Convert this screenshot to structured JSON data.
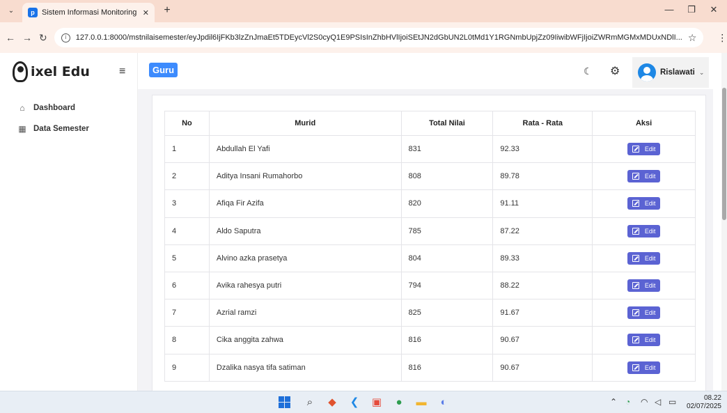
{
  "browser": {
    "tab_title": "Sistem Informasi Monitoring SD",
    "favicon_letter": "p",
    "new_tab": "+",
    "url": "127.0.0.1:8000/mstnilaisemester/eyJpdil6IjFKb3lzZnJmaEt5TDEycVl2S0cyQ1E9PSIsInZhbHVlIjoiSEtJN2dGbUN2L0tMd1Y1RGNmbUpjZz09IiwibWFjIjoiZWRmMGMxMDUxNDlI..."
  },
  "app": {
    "logo_text": "ixel Edu",
    "role_badge": "Guru",
    "user_name": "Rislawati"
  },
  "sidebar": {
    "items": [
      {
        "label": "Dashboard",
        "icon": "home-icon"
      },
      {
        "label": "Data Semester",
        "icon": "calendar-icon"
      }
    ]
  },
  "table": {
    "headers": [
      "No",
      "Murid",
      "Total Nilai",
      "Rata - Rata",
      "Aksi"
    ],
    "edit_label": "Edit",
    "rows": [
      {
        "no": "1",
        "murid": "Abdullah El Yafi",
        "total": "831",
        "rata": "92.33"
      },
      {
        "no": "2",
        "murid": "Aditya Insani Rumahorbo",
        "total": "808",
        "rata": "89.78"
      },
      {
        "no": "3",
        "murid": "Afiqa Fir Azifa",
        "total": "820",
        "rata": "91.11"
      },
      {
        "no": "4",
        "murid": "Aldo Saputra",
        "total": "785",
        "rata": "87.22"
      },
      {
        "no": "5",
        "murid": "Alvino azka prasetya",
        "total": "804",
        "rata": "89.33"
      },
      {
        "no": "6",
        "murid": "Avika rahesya putri",
        "total": "794",
        "rata": "88.22"
      },
      {
        "no": "7",
        "murid": "Azrial ramzi",
        "total": "825",
        "rata": "91.67"
      },
      {
        "no": "8",
        "murid": "Cika anggita zahwa",
        "total": "816",
        "rata": "90.67"
      },
      {
        "no": "9",
        "murid": "Dzalika nasya tifa satiman",
        "total": "816",
        "rata": "90.67"
      }
    ]
  },
  "taskbar": {
    "time": "08.22",
    "date": "02/07/2025"
  },
  "colors": {
    "accent": "#5b63d3",
    "badge": "#3d8bfd",
    "chrome": "#f8dccf"
  }
}
